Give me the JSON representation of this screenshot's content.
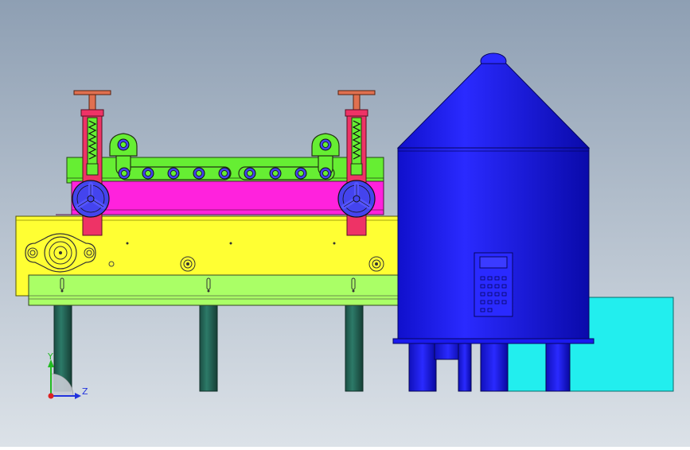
{
  "viewport": {
    "background_top": "#8e9fb3",
    "background_bottom": "#d9dfe6"
  },
  "colors": {
    "yellow_frame": "#ffff33",
    "green_plate": "#aaff66",
    "bright_green": "#66ee33",
    "magenta": "#ff22dd",
    "red_post": "#ee3366",
    "blue_tank": "#1a1aee",
    "dark_blue": "#0b0b88",
    "cyan_box": "#22eeee",
    "teal_leg": "#226655",
    "copper": "#e07050"
  },
  "triad": {
    "y_label": "Y",
    "z_label": "Z",
    "x_color": "#dd2222",
    "y_color": "#22bb22",
    "z_color": "#2233dd"
  },
  "control_panel": {
    "display_icon": "lcd-display-icon",
    "keypad_icon": "keypad-icon"
  }
}
